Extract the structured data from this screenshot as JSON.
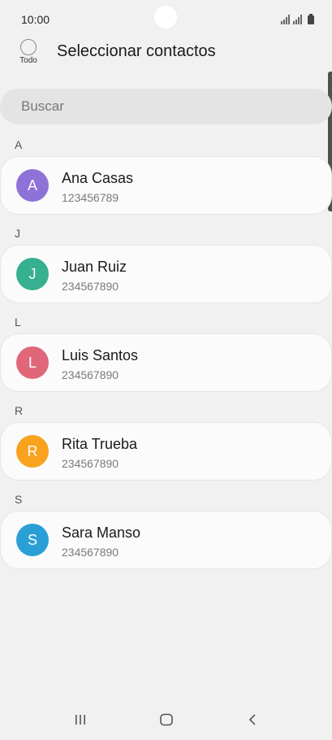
{
  "status_bar": {
    "time": "10:00"
  },
  "header": {
    "select_all_label": "Todo",
    "title": "Seleccionar contactos"
  },
  "search": {
    "placeholder": "Buscar"
  },
  "sections": [
    {
      "letter": "A",
      "contact": {
        "initial": "A",
        "name": "Ana Casas",
        "number": "123456789",
        "avatar_color": "#8e72d8"
      }
    },
    {
      "letter": "J",
      "contact": {
        "initial": "J",
        "name": "Juan Ruiz",
        "number": "234567890",
        "avatar_color": "#36b08f"
      }
    },
    {
      "letter": "L",
      "contact": {
        "initial": "L",
        "name": "Luis Santos",
        "number": "234567890",
        "avatar_color": "#e0677a"
      }
    },
    {
      "letter": "R",
      "contact": {
        "initial": "R",
        "name": "Rita Trueba",
        "number": "234567890",
        "avatar_color": "#f8a21e"
      }
    },
    {
      "letter": "S",
      "contact": {
        "initial": "S",
        "name": "Sara Manso",
        "number": "234567890",
        "avatar_color": "#2a9fd6"
      }
    }
  ],
  "nav_bar": {
    "icons": [
      "recent-apps-icon",
      "home-icon",
      "back-icon"
    ]
  }
}
